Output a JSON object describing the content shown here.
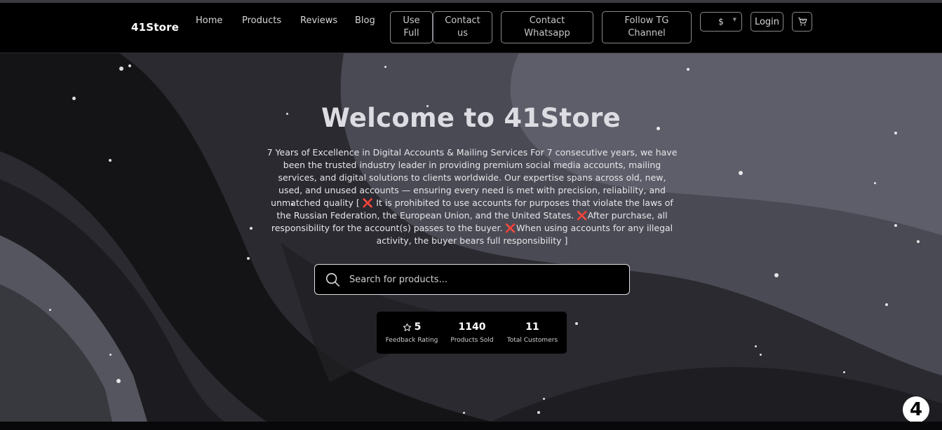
{
  "brand": {
    "name": "41Store"
  },
  "nav": {
    "links": [
      "Home",
      "Products",
      "Reviews",
      "Blog"
    ],
    "buttons": [
      {
        "line1": "Use",
        "line2": "Full"
      },
      {
        "line1": "Contact",
        "line2": "us"
      },
      {
        "line1": "Contact",
        "line2": "Whatsapp"
      },
      {
        "line1": "Follow TG",
        "line2": "Channel"
      }
    ],
    "currency": "$",
    "login": "Login",
    "cart_icon": "cart-icon"
  },
  "hero": {
    "title": "Welcome to 41Store",
    "desc_part1": "7 Years of Excellence in Digital Accounts & Mailing Services For 7 consecutive years, we have been the trusted industry leader in providing premium social media accounts, mailing services, and digital solutions to clients worldwide. Our expertise spans across old, new, used, and unused accounts — ensuring every need is met with precision, reliability, and unmatched quality [ ",
    "x_mark": "❌",
    "desc_part2": " It is prohibited to use accounts for purposes that violate the laws of the Russian Federation, the European Union, and the United States. ",
    "desc_part3": "After purchase, all responsibility for the account(s) passes to the buyer. ",
    "desc_part4": "When using accounts for any illegal activity, the buyer bears full responsibility ]"
  },
  "search": {
    "placeholder": "Search for products..."
  },
  "stats": [
    {
      "value": "5",
      "label": "Feedback Rating",
      "icon": "star-icon"
    },
    {
      "value": "1140",
      "label": "Products Sold"
    },
    {
      "value": "11",
      "label": "Total Customers"
    }
  ],
  "corner_badge": "4",
  "colors": {
    "navbar": "#000000",
    "background": "#26262b",
    "accent_x": "#e0283a"
  }
}
